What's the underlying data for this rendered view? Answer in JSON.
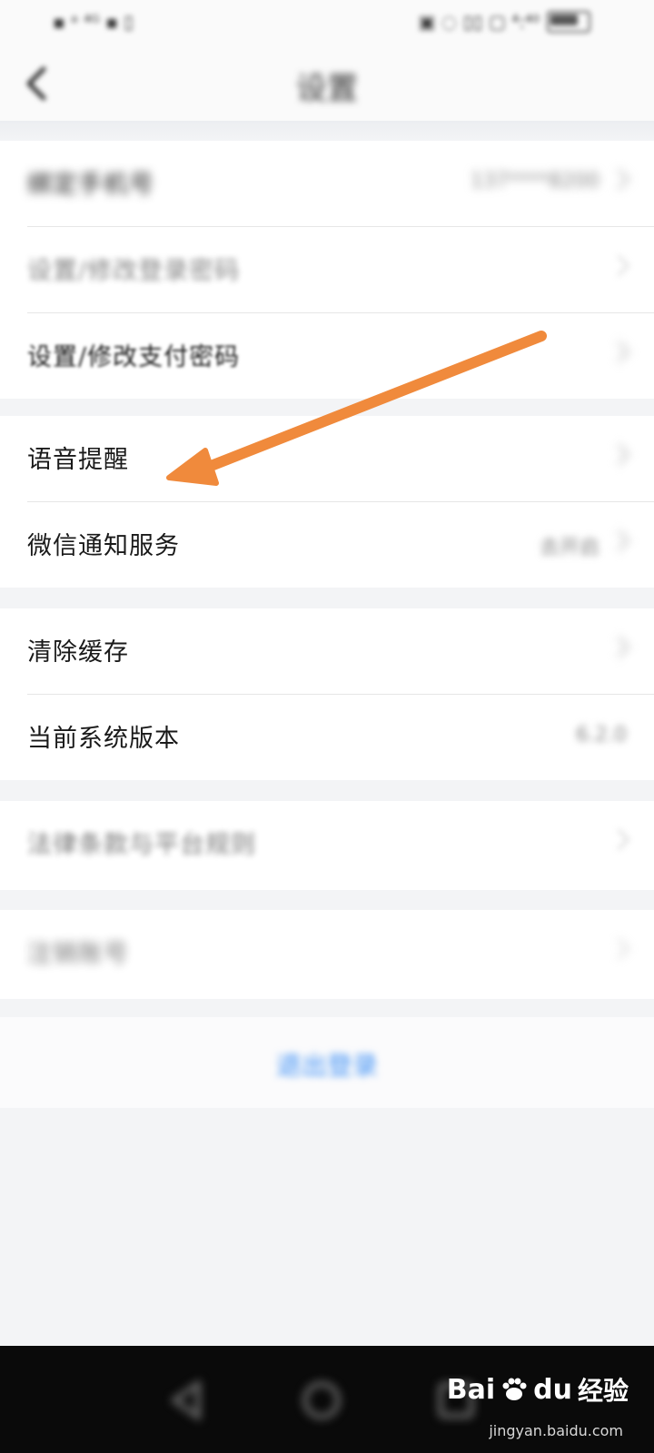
{
  "status_bar": {
    "left": "▪ ᵃ ⁴ᴳ ▪ ▯",
    "right": "▣ ◌ ▯▯ ▢ ⁴:⁴⁰"
  },
  "nav": {
    "title": "设置"
  },
  "group1": {
    "rows": [
      {
        "label": "绑定手机号",
        "value": "137****8200"
      },
      {
        "label": "设置/修改登录密码",
        "value": ""
      },
      {
        "label": "设置/修改支付密码",
        "value": ""
      }
    ]
  },
  "group2": {
    "rows": [
      {
        "label": "语音提醒",
        "value": ""
      },
      {
        "label": "微信通知服务",
        "value": "去开启"
      }
    ]
  },
  "group3": {
    "rows": [
      {
        "label": "清除缓存",
        "value": ""
      },
      {
        "label": "当前系统版本",
        "value": "6.2.0"
      }
    ]
  },
  "group4": {
    "rows": [
      {
        "label": "法律条款与平台规则",
        "value": ""
      }
    ]
  },
  "group5": {
    "rows": [
      {
        "label": "注销账号",
        "value": ""
      }
    ]
  },
  "logout": {
    "label": "退出登录"
  },
  "watermark": {
    "brand": "Bai",
    "brand2": "du",
    "text": "经验",
    "url": "jingyan.baidu.com"
  },
  "colors": {
    "accent": "#3d8ff5",
    "arrow": "#f08a3c",
    "background": "#f3f4f6"
  }
}
